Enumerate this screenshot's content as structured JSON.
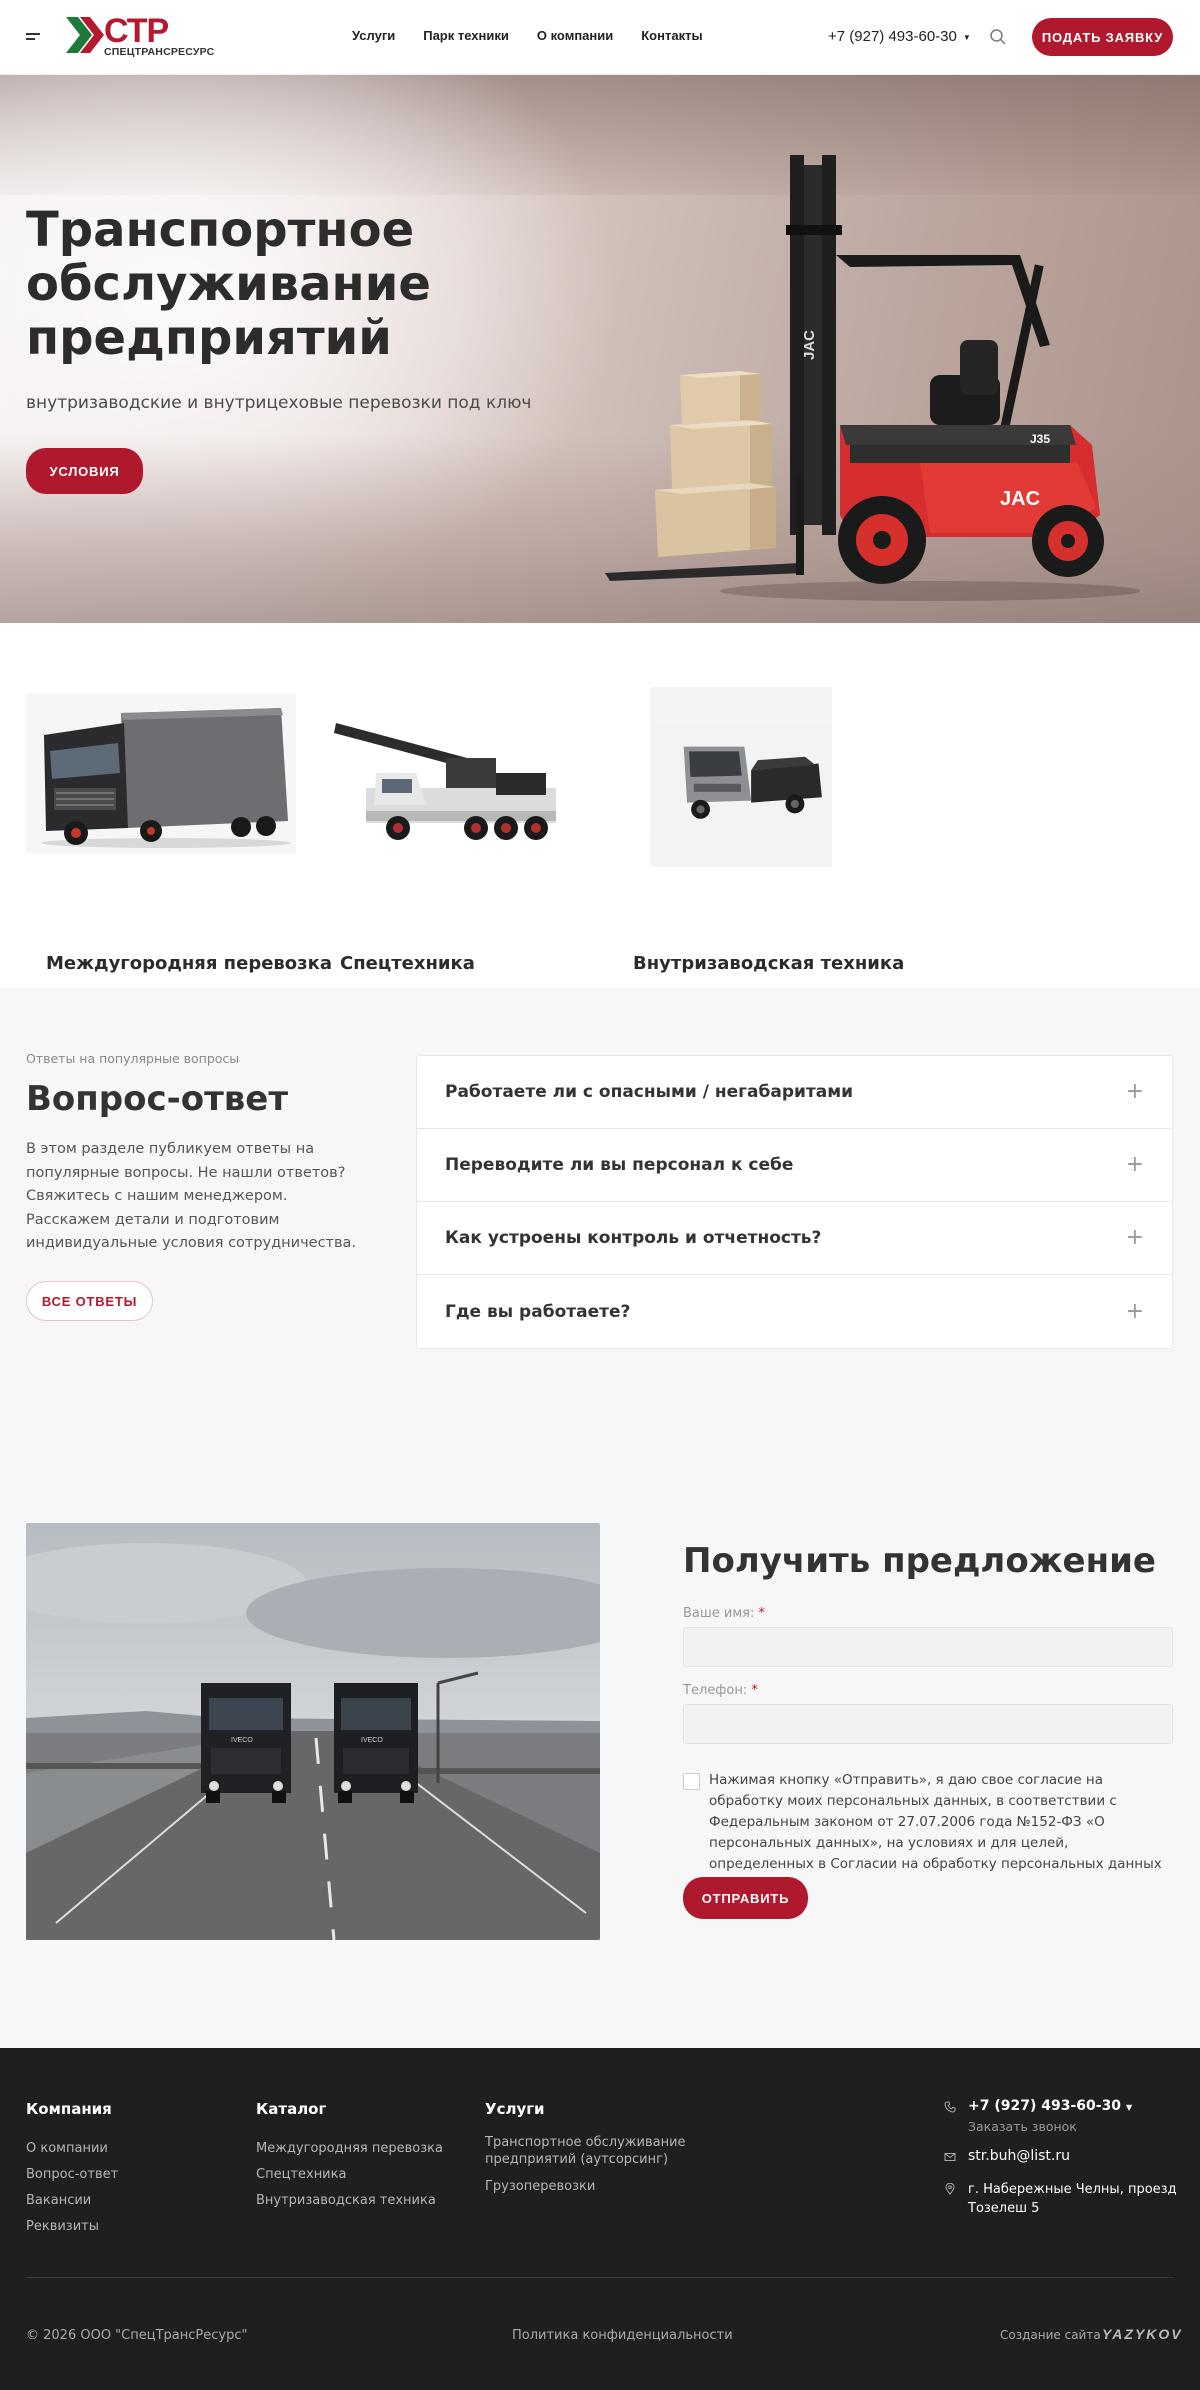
{
  "header": {
    "logo_text": "СТР",
    "logo_sub": "СПЕЦТРАНСРЕСУРС",
    "nav": [
      "Услуги",
      "Парк техники",
      "О компании",
      "Контакты"
    ],
    "phone": "+7 (927) 493-60-30",
    "cta": "ПОДАТЬ ЗАЯВКУ"
  },
  "hero": {
    "title": "Транспортное обслуживание предприятий",
    "subtitle": "внутризаводские и внутрицеховые перевозки под ключ",
    "button": "УСЛОВИЯ",
    "forklift_brand": "JAC",
    "forklift_model": "J35"
  },
  "categories": [
    {
      "title": "Междугородняя перевозка",
      "image": "truck-image"
    },
    {
      "title": "Спецтехника",
      "image": "crane-image"
    },
    {
      "title": "Внутризаводская техника",
      "image": "tractor-image"
    }
  ],
  "faq": {
    "pretitle": "Ответы на популярные вопросы",
    "title": "Вопрос-ответ",
    "text": "В этом разделе публикуем ответы на популярные вопросы. Не нашли ответов? Свяжитесь с нашим менеджером. Расскажем детали и подготовим индивидуальные условия сотрудничества.",
    "button": "ВСЕ ОТВЕТЫ",
    "items": [
      "Работаете ли с опасными / негабаритами",
      "Переводите ли вы персонал к себе",
      "Как устроены контроль и отчетность?",
      "Где вы работаете?"
    ]
  },
  "offer": {
    "title": "Получить предложение",
    "name_label": "Ваше имя:",
    "phone_label": "Телефон:",
    "required_mark": "*",
    "name_value": "",
    "phone_value": "",
    "consent": "Нажимая кнопку «Отправить», я даю свое согласие на обработку моих персональных данных, в соответствии с Федеральным законом от 27.07.2006 года №152-ФЗ «О персональных данных», на условиях и для целей, определенных в Согласии на обработку персональных данных",
    "button": "ОТПРАВИТЬ",
    "truck_brand": "IVECO"
  },
  "footer": {
    "col1_title": "Компания",
    "col1": [
      "О компании",
      "Вопрос-ответ",
      "Вакансии",
      "Реквизиты"
    ],
    "col2_title": "Каталог",
    "col2": [
      "Междугородняя перевозка",
      "Спецтехника",
      "Внутризаводская техника"
    ],
    "col3_title": "Услуги",
    "col3": [
      "Транспортное обслуживание предприятий (аутсорсинг)",
      "Грузоперевозки"
    ],
    "phone": "+7 (927) 493-60-30",
    "callback": "Заказать звонок",
    "email": "str.buh@list.ru",
    "address": "г. Набережные Челны, проезд Тозелеш 5",
    "copyright": "© 2026 ООО \"СпецТрансРесурс\"",
    "privacy": "Политика конфиденциальности",
    "created": "Создание сайта",
    "creator": "YAZYKOV"
  },
  "colors": {
    "accent": "#b0182d",
    "logo_green": "#1e7a3c",
    "footer_bg": "#1f1f1f",
    "faq_bg": "#f7f7f7"
  }
}
